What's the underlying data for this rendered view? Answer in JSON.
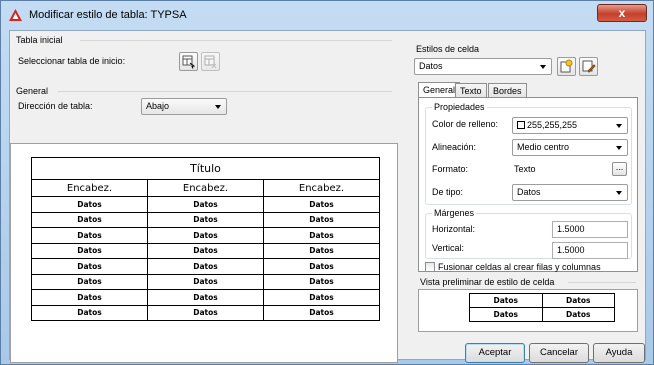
{
  "window": {
    "title": "Modificar estilo de tabla: TYPSA",
    "close_glyph": "x"
  },
  "left": {
    "tabla_inicial": {
      "label": "Tabla inicial",
      "select_label": "Seleccionar tabla de inicio:"
    },
    "general": {
      "label": "General",
      "direction_label": "Dirección de tabla:",
      "direction_value": "Abajo"
    }
  },
  "preview_table": {
    "title": "Título",
    "headers": [
      "Encabez.",
      "Encabez.",
      "Encabez."
    ],
    "cell": "Datos",
    "rows": 8
  },
  "cell_styles": {
    "label": "Estilos de celda",
    "selected": "Datos",
    "tabs": [
      "General",
      "Texto",
      "Bordes"
    ],
    "properties": {
      "label": "Propiedades",
      "fill_label": "Color de relleno:",
      "fill_value": "255,255,255",
      "align_label": "Alineación:",
      "align_value": "Medio centro",
      "format_label": "Formato:",
      "format_value": "Texto",
      "format_btn": "...",
      "type_label": "De tipo:",
      "type_value": "Datos"
    },
    "margins": {
      "label": "Márgenes",
      "horizontal_label": "Horizontal:",
      "horizontal_value": "1.5000",
      "vertical_label": "Vertical:",
      "vertical_value": "1.5000"
    },
    "merge_label": "Fusionar celdas al crear filas y columnas",
    "merge_checked": false,
    "preview": {
      "label": "Vista preliminar de estilo de celda",
      "cells": [
        "Datos",
        "Datos",
        "Datos",
        "Datos"
      ]
    }
  },
  "buttons": {
    "ok": "Aceptar",
    "cancel": "Cancelar",
    "help": "Ayuda"
  },
  "colors": {
    "accent": "#3c7fb1",
    "close": "#c5402c",
    "icon_red": "#d9231c"
  }
}
